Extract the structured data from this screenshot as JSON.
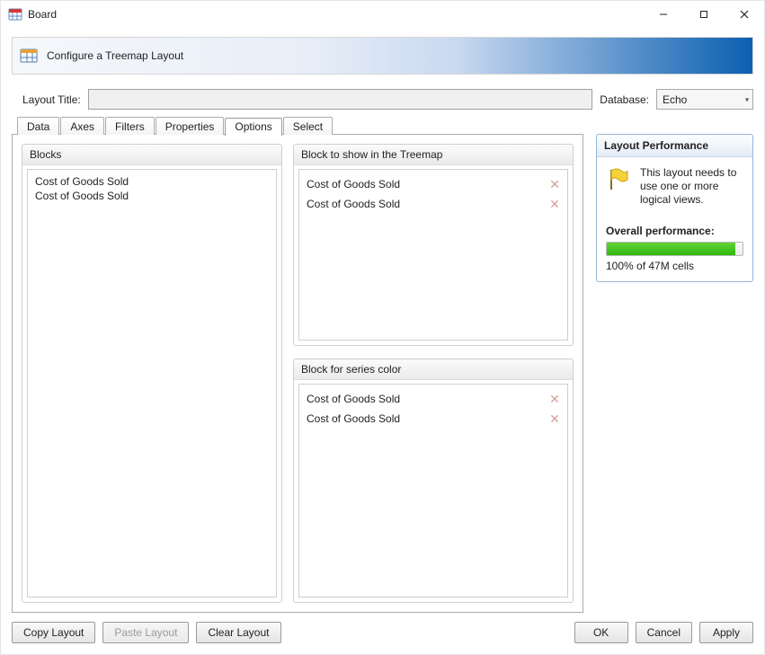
{
  "window": {
    "title": "Board"
  },
  "banner": {
    "text": "Configure a Treemap Layout"
  },
  "toprow": {
    "layout_title_label": "Layout Title:",
    "layout_title_value": "",
    "database_label": "Database:",
    "database_value": "Echo"
  },
  "tabs": {
    "data": "Data",
    "axes": "Axes",
    "filters": "Filters",
    "properties": "Properties",
    "options": "Options",
    "select": "Select"
  },
  "groups": {
    "blocks": "Blocks",
    "treemap": "Block to show in the Treemap",
    "seriescolor": "Block for series color"
  },
  "blocks_items": [
    "Cost of Goods Sold",
    "Cost of Goods Sold"
  ],
  "treemap_items": [
    "Cost of Goods Sold",
    "Cost of Goods Sold"
  ],
  "seriescolor_items": [
    "Cost of Goods Sold",
    "Cost of Goods Sold"
  ],
  "performance": {
    "header": "Layout Performance",
    "warn_text": "This layout needs to use one or more logical views.",
    "overall_label": "Overall performance:",
    "overall_text": "100% of 47M cells"
  },
  "footer": {
    "copy": "Copy Layout",
    "paste": "Paste Layout",
    "clear": "Clear Layout",
    "ok": "OK",
    "cancel": "Cancel",
    "apply": "Apply"
  }
}
